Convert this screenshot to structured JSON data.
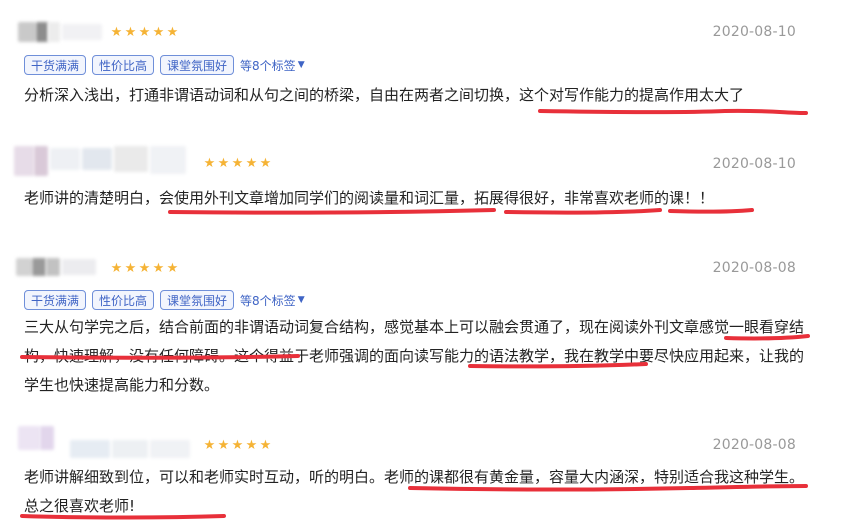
{
  "reviews": [
    {
      "date": "2020-08-10",
      "rating": 5,
      "tags": [
        "干货满满",
        "性价比高",
        "课堂氛围好"
      ],
      "more_tags": "等8个标签",
      "text": "分析深入浅出，打通非谓语动词和从句之间的桥梁，自由在两者之间切换，这个对写作能力的提高作用太大了"
    },
    {
      "date": "2020-08-10",
      "rating": 5,
      "tags": [],
      "more_tags": "",
      "text": "老师讲的清楚明白，会使用外刊文章增加同学们的阅读量和词汇量，拓展得很好，非常喜欢老师的课！！"
    },
    {
      "date": "2020-08-08",
      "rating": 5,
      "tags": [
        "干货满满",
        "性价比高",
        "课堂氛围好"
      ],
      "more_tags": "等8个标签",
      "text": "三大从句学完之后，结合前面的非谓语动词复合结构，感觉基本上可以融会贯通了，现在阅读外刊文章感觉一眼看穿结构，快速理解，没有任何障碍。这个得益于老师强调的面向读写能力的语法教学，我在教学中要尽快应用起来，让我的学生也快速提高能力和分数。"
    },
    {
      "date": "2020-08-08",
      "rating": 5,
      "tags": [],
      "more_tags": "",
      "text": "老师讲解细致到位，可以和老师实时互动，听的明白。老师的课都很有黄金量，容量大内涵深，特别适合我这种学生。总之很喜欢老师!"
    }
  ],
  "colors": {
    "star": "#f5b335",
    "tag_border": "#6f8fd9",
    "tag_text": "#3f64c5",
    "underline": "#e8303a",
    "date": "#999999"
  }
}
